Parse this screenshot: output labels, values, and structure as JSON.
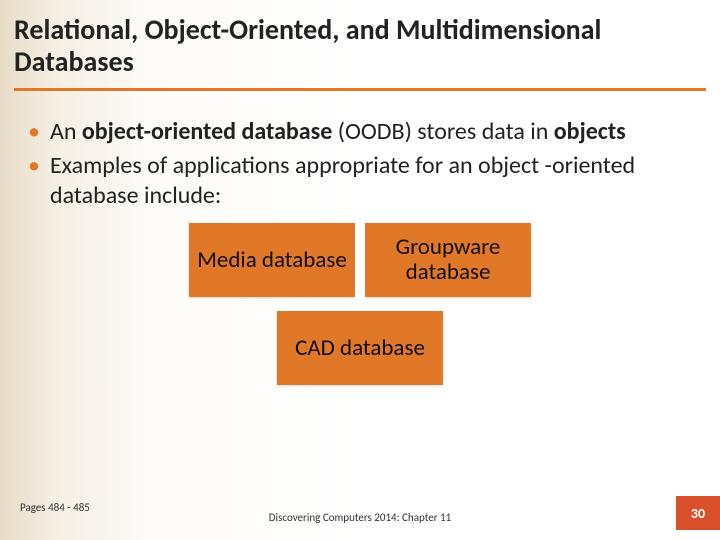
{
  "title": "Relational, Object-Oriented, and Multidimensional Databases",
  "bullets": [
    {
      "prefix": "An ",
      "bold1": "object-oriented database",
      "mid": " (OODB) stores data in ",
      "bold2": "objects",
      "suffix": ""
    },
    {
      "text": "Examples of applications appropriate for an object -oriented database include:"
    }
  ],
  "tiles": {
    "row1": [
      "Media database",
      "Groupware database"
    ],
    "row2": [
      "CAD database"
    ]
  },
  "footer": {
    "pages_ref": "Pages 484 - 485",
    "center": "Discovering Computers 2014: Chapter 11",
    "page_num": "30"
  }
}
